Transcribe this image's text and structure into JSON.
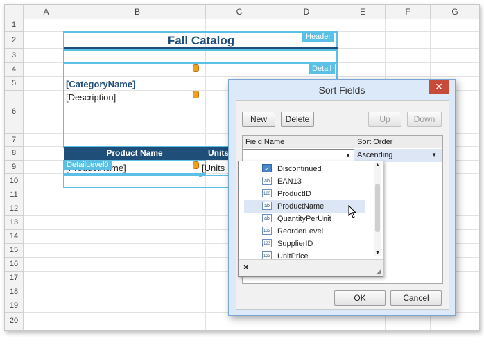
{
  "spreadsheet": {
    "columns": [
      "A",
      "B",
      "C",
      "D",
      "E",
      "F",
      "G"
    ],
    "rows": [
      "1",
      "2",
      "3",
      "4",
      "5",
      "6",
      "7",
      "8",
      "9",
      "10",
      "11",
      "12",
      "13",
      "14",
      "15",
      "16",
      "17",
      "18",
      "19",
      "20"
    ],
    "title": "Fall Catalog",
    "category_field": "[CategoryName]",
    "description_field": "[Description]",
    "table_header_product": "Product Name",
    "table_header_units": "Units",
    "product_field": "[ProductName]",
    "units_field": "[Units",
    "band_tags": {
      "header": "Header",
      "detail": "Detail",
      "detail_level0": "DetailLevel0"
    },
    "title_color": "#1f4e79",
    "band_color": "#5bc0e6"
  },
  "dialog": {
    "title": "Sort Fields",
    "buttons": {
      "new": "New",
      "delete": "Delete",
      "up": "Up",
      "down": "Down",
      "ok": "OK",
      "cancel": "Cancel"
    },
    "grid": {
      "col_field_name": "Field Name",
      "col_sort_order": "Sort Order",
      "field_value": "",
      "sort_value": "Ascending"
    },
    "field_list": [
      {
        "label": "Discontinued",
        "icon": "checkbox-icon",
        "highlighted": false
      },
      {
        "label": "EAN13",
        "icon": "text-field-icon",
        "highlighted": false
      },
      {
        "label": "ProductID",
        "icon": "number-field-icon",
        "highlighted": false
      },
      {
        "label": "ProductName",
        "icon": "text-field-icon",
        "highlighted": true
      },
      {
        "label": "QuantityPerUnit",
        "icon": "text-field-icon",
        "highlighted": false
      },
      {
        "label": "ReorderLevel",
        "icon": "number-field-icon",
        "highlighted": false
      },
      {
        "label": "SupplierID",
        "icon": "number-field-icon",
        "highlighted": false
      },
      {
        "label": "UnitPrice",
        "icon": "number-field-icon",
        "highlighted": false
      }
    ],
    "icon_text": {
      "text": "ab",
      "number": "123"
    }
  }
}
